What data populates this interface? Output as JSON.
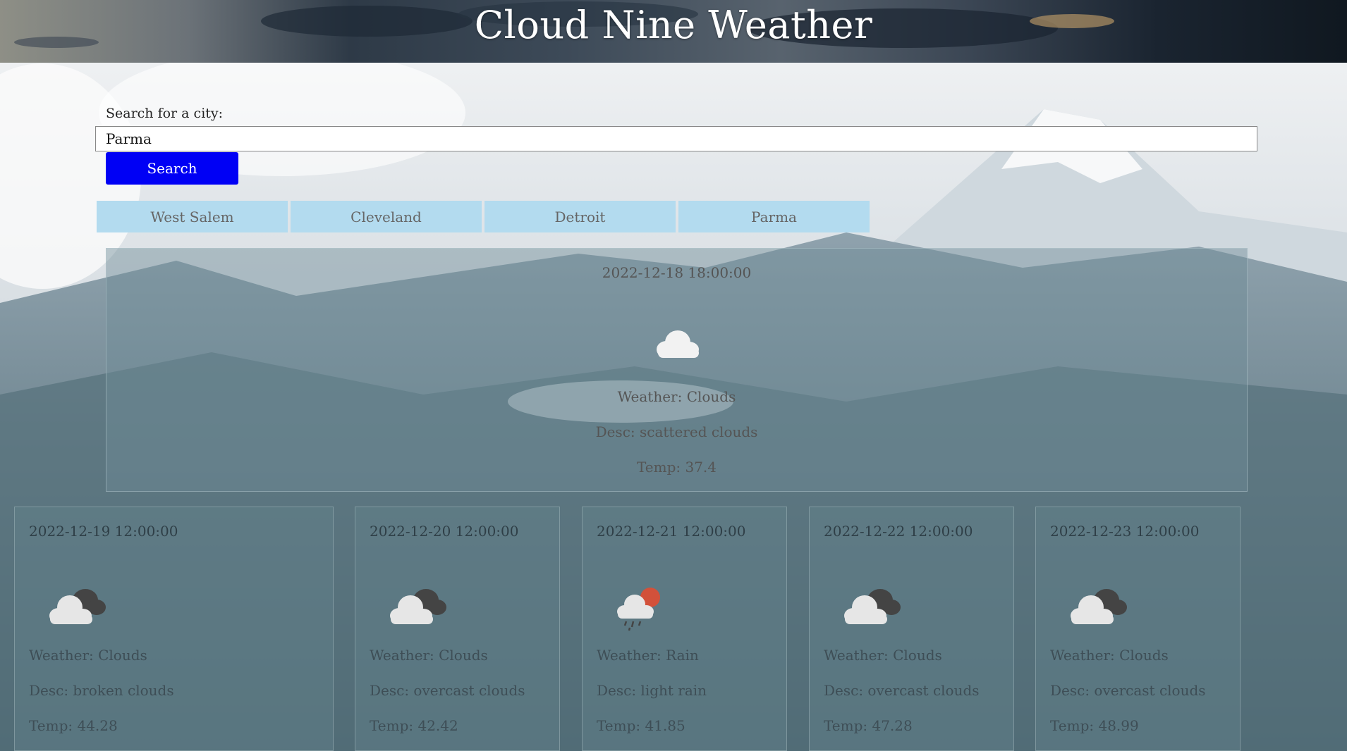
{
  "header": {
    "title": "Cloud Nine Weather"
  },
  "search": {
    "label": "Search for a city:",
    "value": "Parma",
    "button_label": "Search"
  },
  "history": [
    "West Salem",
    "Cleveland",
    "Detroit",
    "Parma"
  ],
  "current": {
    "date": "2022-12-18 18:00:00",
    "icon": "scattered-clouds-icon",
    "weather": "Weather: Clouds",
    "desc": "Desc: scattered clouds",
    "temp": "Temp: 37.4"
  },
  "forecast": [
    {
      "date": "2022-12-19 12:00:00",
      "icon": "broken-clouds-icon",
      "weather": "Weather: Clouds",
      "desc": "Desc: broken clouds",
      "temp": "Temp: 44.28"
    },
    {
      "date": "2022-12-20 12:00:00",
      "icon": "overcast-clouds-icon",
      "weather": "Weather: Clouds",
      "desc": "Desc: overcast clouds",
      "temp": "Temp: 42.42"
    },
    {
      "date": "2022-12-21 12:00:00",
      "icon": "light-rain-icon",
      "weather": "Weather: Rain",
      "desc": "Desc: light rain",
      "temp": "Temp: 41.85"
    },
    {
      "date": "2022-12-22 12:00:00",
      "icon": "overcast-clouds-icon",
      "weather": "Weather: Clouds",
      "desc": "Desc: overcast clouds",
      "temp": "Temp: 47.28"
    },
    {
      "date": "2022-12-23 12:00:00",
      "icon": "overcast-clouds-icon",
      "weather": "Weather: Clouds",
      "desc": "Desc: overcast clouds",
      "temp": "Temp: 48.99"
    }
  ],
  "colors": {
    "search_button": "#0000f5",
    "history_button": "#b3dbef",
    "title": "#ffffff"
  }
}
